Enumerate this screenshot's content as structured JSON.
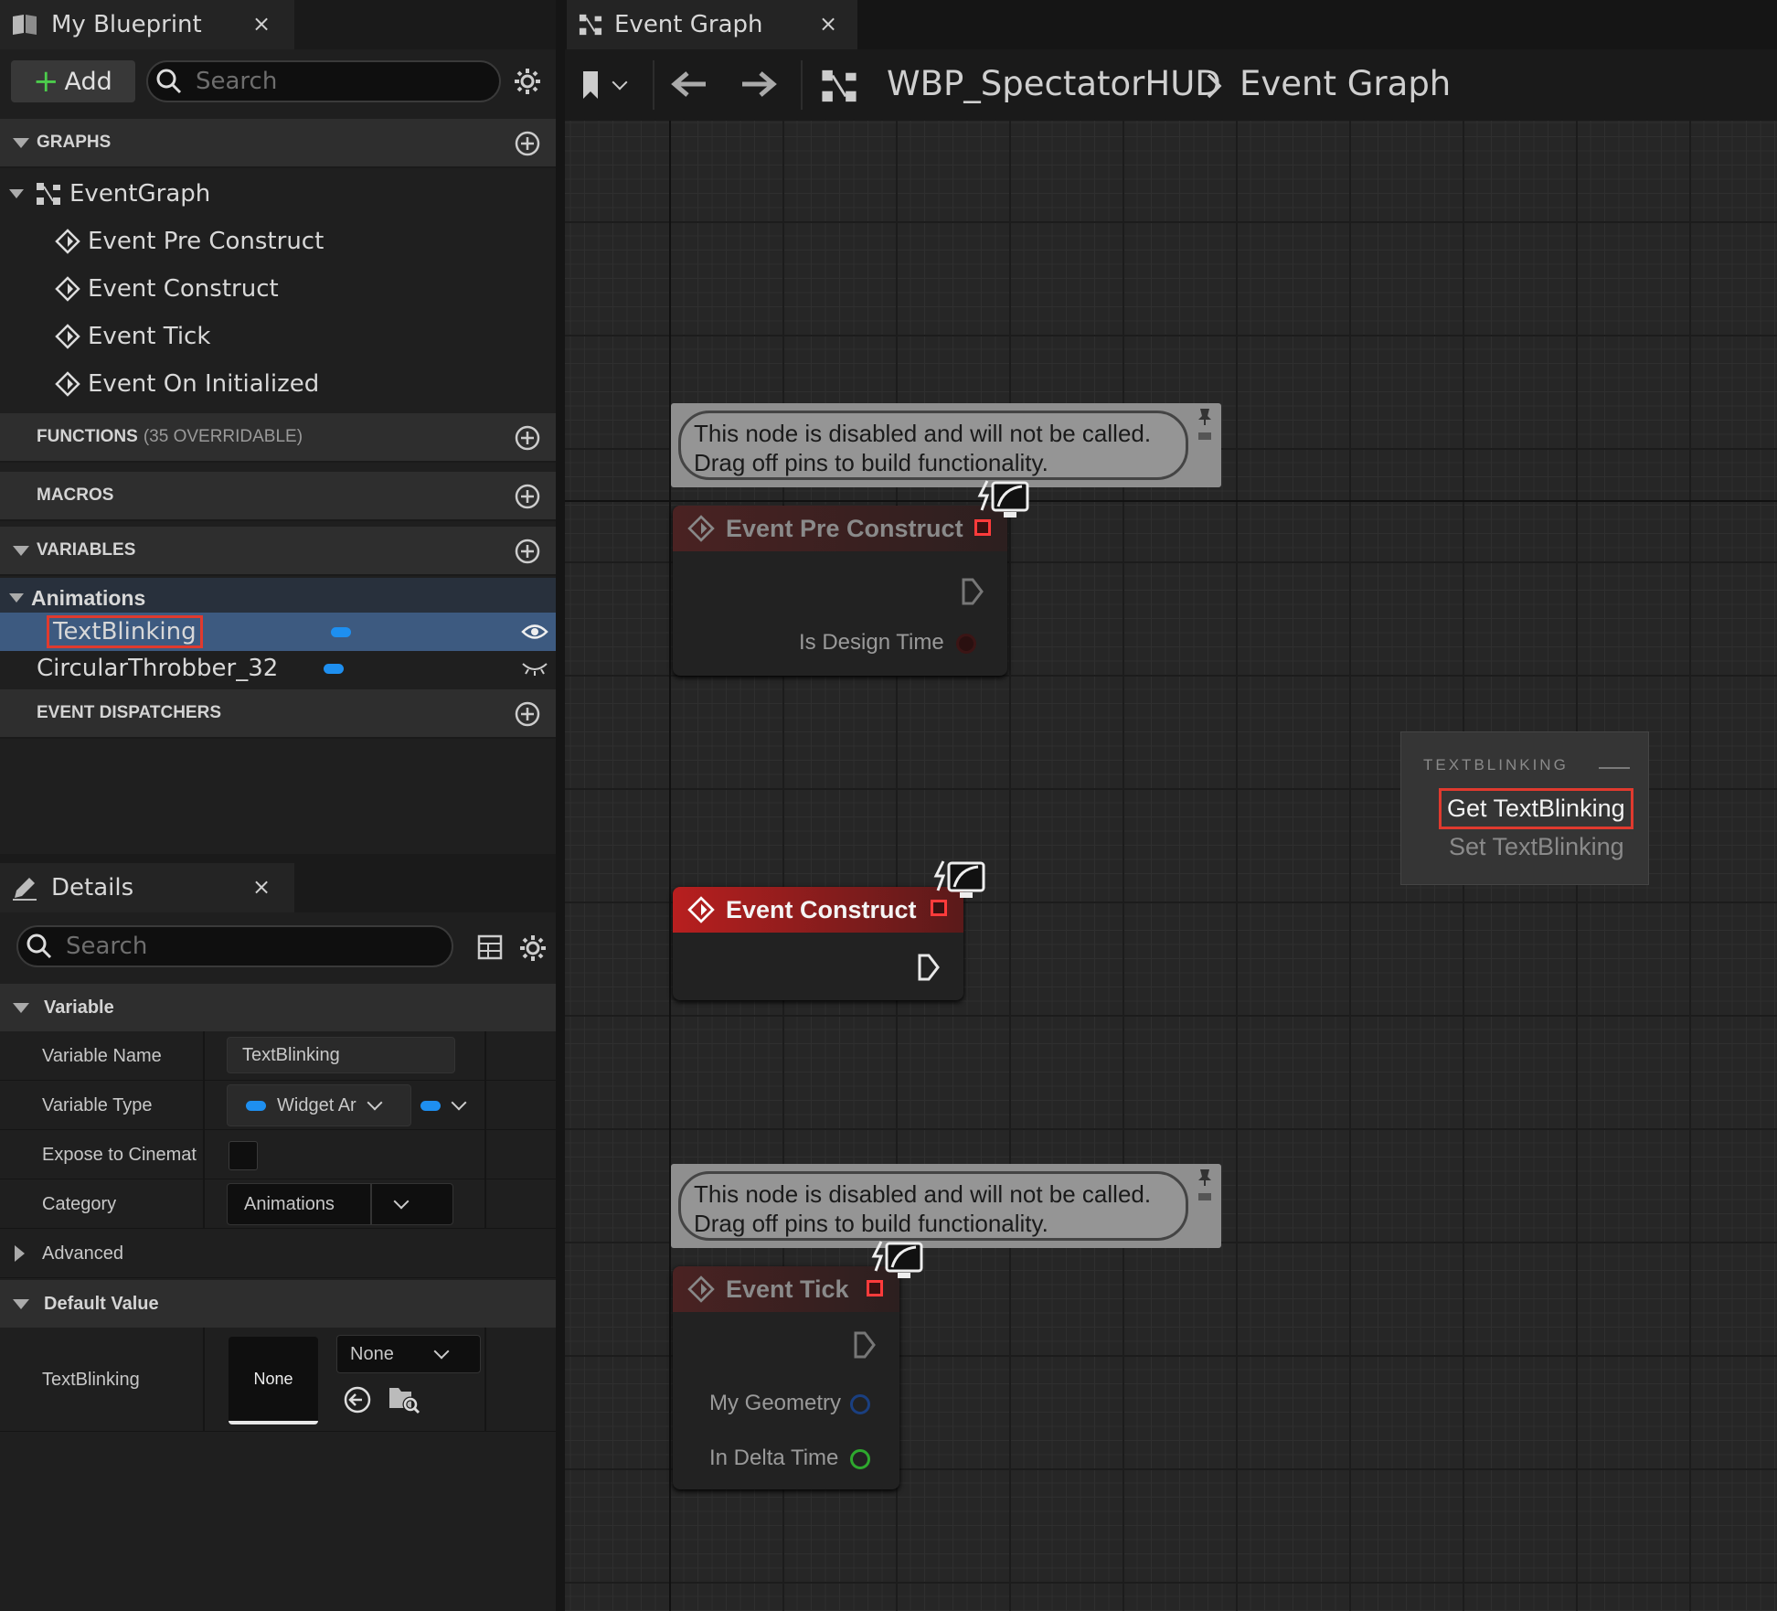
{
  "my_blueprint": {
    "tab_title": "My Blueprint",
    "close": "×",
    "add_label": "Add",
    "search_placeholder": "Search",
    "sections": {
      "graphs": "GRAPHS",
      "functions": "FUNCTIONS",
      "functions_sub": "(35 OVERRIDABLE)",
      "macros": "MACROS",
      "variables": "VARIABLES",
      "event_dispatchers": "EVENT DISPATCHERS"
    },
    "event_graph": "EventGraph",
    "events": [
      "Event Pre Construct",
      "Event Construct",
      "Event Tick",
      "Event On Initialized"
    ],
    "var_category": "Animations",
    "variables": [
      {
        "name": "TextBlinking",
        "visible": true,
        "selected": true
      },
      {
        "name": "CircularThrobber_32",
        "visible": false,
        "selected": false
      }
    ]
  },
  "details": {
    "tab_title": "Details",
    "close": "×",
    "search_placeholder": "Search",
    "cat_variable": "Variable",
    "rows": {
      "variable_name_label": "Variable Name",
      "variable_name_value": "TextBlinking",
      "variable_type_label": "Variable Type",
      "variable_type_value": "Widget Ar",
      "expose_label": "Expose to Cinemat",
      "category_label": "Category",
      "category_value": "Animations"
    },
    "advanced": "Advanced",
    "cat_default": "Default Value",
    "default_label": "TextBlinking",
    "default_thumb": "None",
    "default_dropdown": "None"
  },
  "graph": {
    "tab_title": "Event Graph",
    "close": "×",
    "breadcrumb_root": "WBP_SpectatorHUD",
    "breadcrumb_leaf": "Event Graph",
    "comment_line1": "This node is disabled and will not be called.",
    "comment_line2": "Drag off pins to build functionality.",
    "node_pre_construct": "Event Pre Construct",
    "pin_design_time": "Is Design Time",
    "node_construct": "Event Construct",
    "node_tick": "Event Tick",
    "pin_geometry": "My Geometry",
    "pin_delta": "In Delta Time"
  },
  "context_menu": {
    "caption": "TEXTBLINKING",
    "get": "Get TextBlinking",
    "set": "Set TextBlinking"
  },
  "colors": {
    "accent_selected": "#3d5a80",
    "highlight": "#e03a2e",
    "pin_blue": "#1e8ff0",
    "pin_green": "#2ea82e"
  }
}
